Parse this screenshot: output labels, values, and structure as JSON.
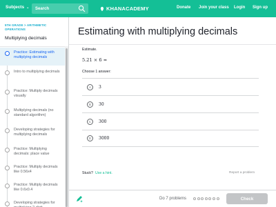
{
  "topbar": {
    "subjects_label": "Subjects",
    "search_placeholder": "Search",
    "logo_text": "KHANACADEMY",
    "links": [
      "Donate",
      "Join your class",
      "Login",
      "Sign up"
    ]
  },
  "sidebar": {
    "breadcrumb": "5TH GRADE > ARITHMETIC OPERATIONS",
    "unit_title": "Multiplying decimals",
    "items": [
      {
        "label": "Practice: Estimating with multiplying decimals",
        "active": true
      },
      {
        "label": "Intro to multiplying decimals",
        "active": false
      },
      {
        "label": "Practice: Multiply decimals visually",
        "active": false
      },
      {
        "label": "Multiplying decimals (no standard algorithm)",
        "active": false
      },
      {
        "label": "Developing strategies for multiplying decimals",
        "active": false
      },
      {
        "label": "Practice: Multiplying decimals: place value",
        "active": false
      },
      {
        "label": "Practice: Multiply decimals like 0.56x4",
        "active": false
      },
      {
        "label": "Practice: Multiply decimals like 0.6x0.4",
        "active": false
      },
      {
        "label": "Developing strategies for multiplying 2-digit",
        "active": false
      }
    ]
  },
  "main": {
    "title": "Estimating with multiplying decimals",
    "question_label": "Estimate.",
    "expression": "5.21 × 6 ≈",
    "prompt": "Choose 1 answer:",
    "choices": [
      {
        "letter": "A",
        "value": "3"
      },
      {
        "letter": "B",
        "value": "30"
      },
      {
        "letter": "C",
        "value": "300"
      },
      {
        "letter": "D",
        "value": "3000"
      }
    ],
    "stuck_label": "Stuck?",
    "hint_label": "Use a hint.",
    "report_label": "Report a problem"
  },
  "bottombar": {
    "progress_label": "Do 7 problems",
    "problem_count": 7,
    "check_label": "Check"
  },
  "colors": {
    "brand_green": "#14bf96",
    "active_blue": "#1865f2",
    "active_bg": "#e5f2f8",
    "disabled_button": "#c3c5c7"
  },
  "icons": {
    "subjects_chevron": "chevron-down-icon",
    "search": "search-icon",
    "logo": "leaf-icon",
    "bottom_left": "pencil-sparkle-icon"
  }
}
